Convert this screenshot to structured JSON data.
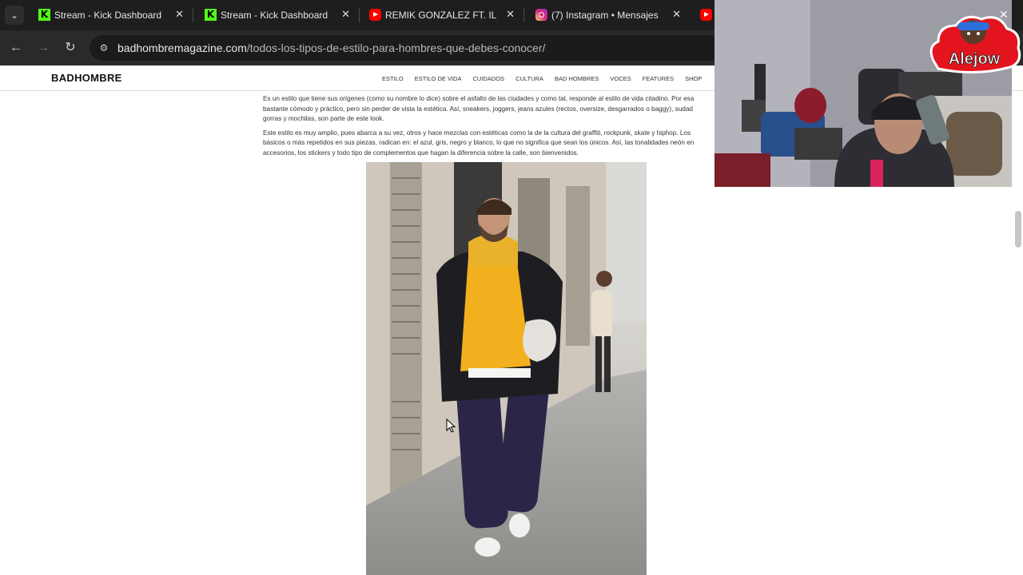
{
  "tabs": [
    {
      "title": "Stream - Kick Dashboard",
      "icon": "kick-icon"
    },
    {
      "title": "Stream - Kick Dashboard",
      "icon": "kick-icon"
    },
    {
      "title": "REMIK GONZALEZ FT. ILUMI",
      "icon": "youtube-icon"
    },
    {
      "title": "(7) Instagram • Mensajes",
      "icon": "instagram-icon"
    }
  ],
  "address": {
    "host": "badhombremagazine.com",
    "path": "/todos-los-tipos-de-estilo-para-hombres-que-debes-conocer/"
  },
  "site": {
    "logo": "BADHOMBRE",
    "nav": [
      "ESTILO",
      "ESTILO DE VIDA",
      "CUIDADOS",
      "CULTURA",
      "BAD HOMBRES",
      "VOCES",
      "FEATURES",
      "SHOP"
    ]
  },
  "article": {
    "lines": [
      "Es un estilo que tiene sus orígenes (como su nombre lo dice) sobre el asfalto de las ciudades y como tal, responde al estilo de vida citadino. Por esa",
      "bastante cómodo y práctico, pero sin perder de vista la estética. Así, sneakers, joggers, jeans azules (rectos, oversize, desgarrados o baggy), sudad",
      "gorras y mochilas, son parte de este look.",
      "Este estilo es muy amplio, pues abarca a su vez, otros y hace mezclas con estéticas como la de la cultura del graffiti, rockpunk, skate y hiphop. Los",
      "básicos o más repetidos en sus piezas, radican en: el azul, gris, negro y blanco, lo que no significa que sean los únicos. Así, las tonalidades neón en",
      "accesorios, los stickers y todo tipo de complementos que hagan la diferencia sobre la calle, son bienvenidos."
    ]
  },
  "overlay": {
    "badge_text": "Alejow"
  },
  "colors": {
    "kick_green": "#53fc18",
    "hoodie_yellow": "#f2b01e",
    "badge_red": "#e3141d"
  }
}
